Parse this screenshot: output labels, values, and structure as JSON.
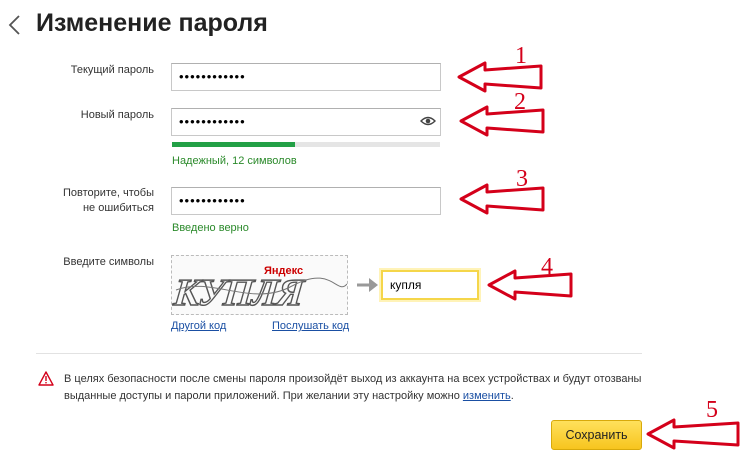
{
  "header": {
    "title": "Изменение пароля"
  },
  "form": {
    "current_password": {
      "label": "Текущий пароль",
      "value": "••••••••••••"
    },
    "new_password": {
      "label": "Новый пароль",
      "value": "••••••••••••",
      "strength": 0.46,
      "strength_text": "Надежный, 12 символов",
      "strength_color": "#22a046"
    },
    "repeat_password": {
      "label_line1": "Повторите, чтобы",
      "label_line2": "не ошибиться",
      "value": "••••••••••••",
      "status": "Введено верно"
    },
    "captcha": {
      "label": "Введите символы",
      "image_text": "КУПЛЯ",
      "brand": "Яндекс",
      "value": "купля",
      "other_code_link": "Другой код",
      "listen_code_link": "Послушать код"
    }
  },
  "notice": {
    "text": "В целях безопасности после смены пароля произойдёт выход из аккаунта на всех устройствах и будут отозваны выданные доступы и пароли приложений. При желании эту настройку можно ",
    "link": "изменить",
    "suffix": "."
  },
  "actions": {
    "save_label": "Сохранить"
  },
  "annotations": [
    "1",
    "2",
    "3",
    "4",
    "5"
  ],
  "colors": {
    "accent": "#f7c51e",
    "annotation": "#d4001a",
    "link": "#1a4fa3",
    "success": "#2b8a2b"
  }
}
